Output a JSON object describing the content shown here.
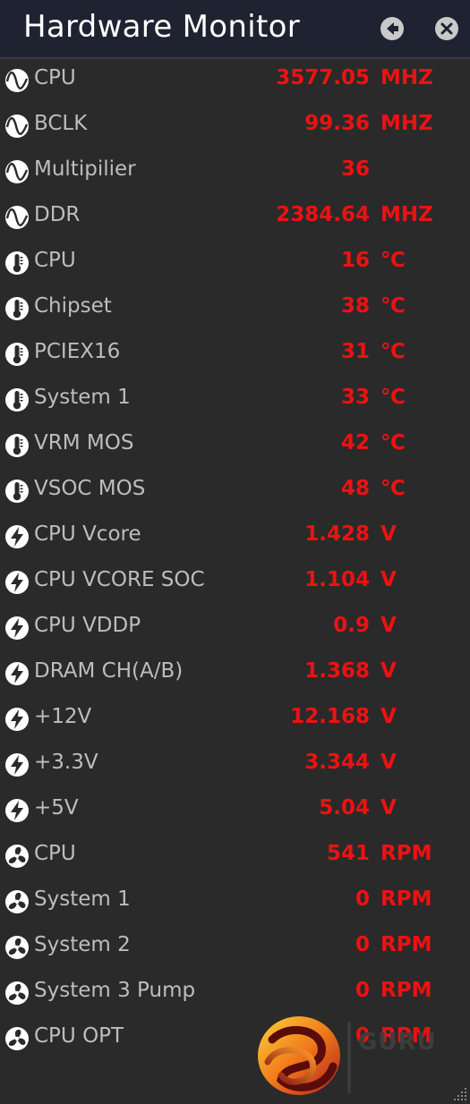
{
  "window": {
    "title": "Hardware Monitor",
    "back_icon": "back-arrow-icon",
    "close_icon": "close-icon"
  },
  "colors": {
    "title_bar": "#1f2230",
    "background": "#2a2a2a",
    "label": "#bdbdbd",
    "value": "#ee1111"
  },
  "sensors": [
    {
      "icon": "frequency-wave-icon",
      "label": "CPU",
      "value": "3577.05",
      "unit": "MHZ"
    },
    {
      "icon": "frequency-wave-icon",
      "label": "BCLK",
      "value": "99.36",
      "unit": "MHZ"
    },
    {
      "icon": "frequency-wave-icon",
      "label": "Multipilier",
      "value": "36",
      "unit": ""
    },
    {
      "icon": "frequency-wave-icon",
      "label": "DDR",
      "value": "2384.64",
      "unit": "MHZ"
    },
    {
      "icon": "thermometer-icon",
      "label": "CPU",
      "value": "16",
      "unit": "℃"
    },
    {
      "icon": "thermometer-icon",
      "label": "Chipset",
      "value": "38",
      "unit": "℃"
    },
    {
      "icon": "thermometer-icon",
      "label": "PCIEX16",
      "value": "31",
      "unit": "℃"
    },
    {
      "icon": "thermometer-icon",
      "label": "System 1",
      "value": "33",
      "unit": "℃"
    },
    {
      "icon": "thermometer-icon",
      "label": "VRM MOS",
      "value": "42",
      "unit": "℃"
    },
    {
      "icon": "thermometer-icon",
      "label": "VSOC MOS",
      "value": "48",
      "unit": "℃"
    },
    {
      "icon": "lightning-icon",
      "label": "CPU Vcore",
      "value": "1.428",
      "unit": "V"
    },
    {
      "icon": "lightning-icon",
      "label": "CPU VCORE SOC",
      "value": "1.104",
      "unit": "V"
    },
    {
      "icon": "lightning-icon",
      "label": "CPU VDDP",
      "value": "0.9",
      "unit": "V"
    },
    {
      "icon": "lightning-icon",
      "label": "DRAM CH(A/B)",
      "value": "1.368",
      "unit": "V"
    },
    {
      "icon": "lightning-icon",
      "label": "+12V",
      "value": "12.168",
      "unit": "V"
    },
    {
      "icon": "lightning-icon",
      "label": "+3.3V",
      "value": "3.344",
      "unit": "V"
    },
    {
      "icon": "lightning-icon",
      "label": "+5V",
      "value": "5.04",
      "unit": "V"
    },
    {
      "icon": "fan-icon",
      "label": "CPU",
      "value": "541",
      "unit": "RPM"
    },
    {
      "icon": "fan-icon",
      "label": "System 1",
      "value": "0",
      "unit": "RPM"
    },
    {
      "icon": "fan-icon",
      "label": "System 2",
      "value": "0",
      "unit": "RPM"
    },
    {
      "icon": "fan-icon",
      "label": "System 3 Pump",
      "value": "0",
      "unit": "RPM"
    },
    {
      "icon": "fan-icon",
      "label": "CPU OPT",
      "value": "0",
      "unit": "RPM"
    }
  ],
  "watermark": {
    "icon": "kitguru-logo-icon",
    "text": "GURU"
  }
}
